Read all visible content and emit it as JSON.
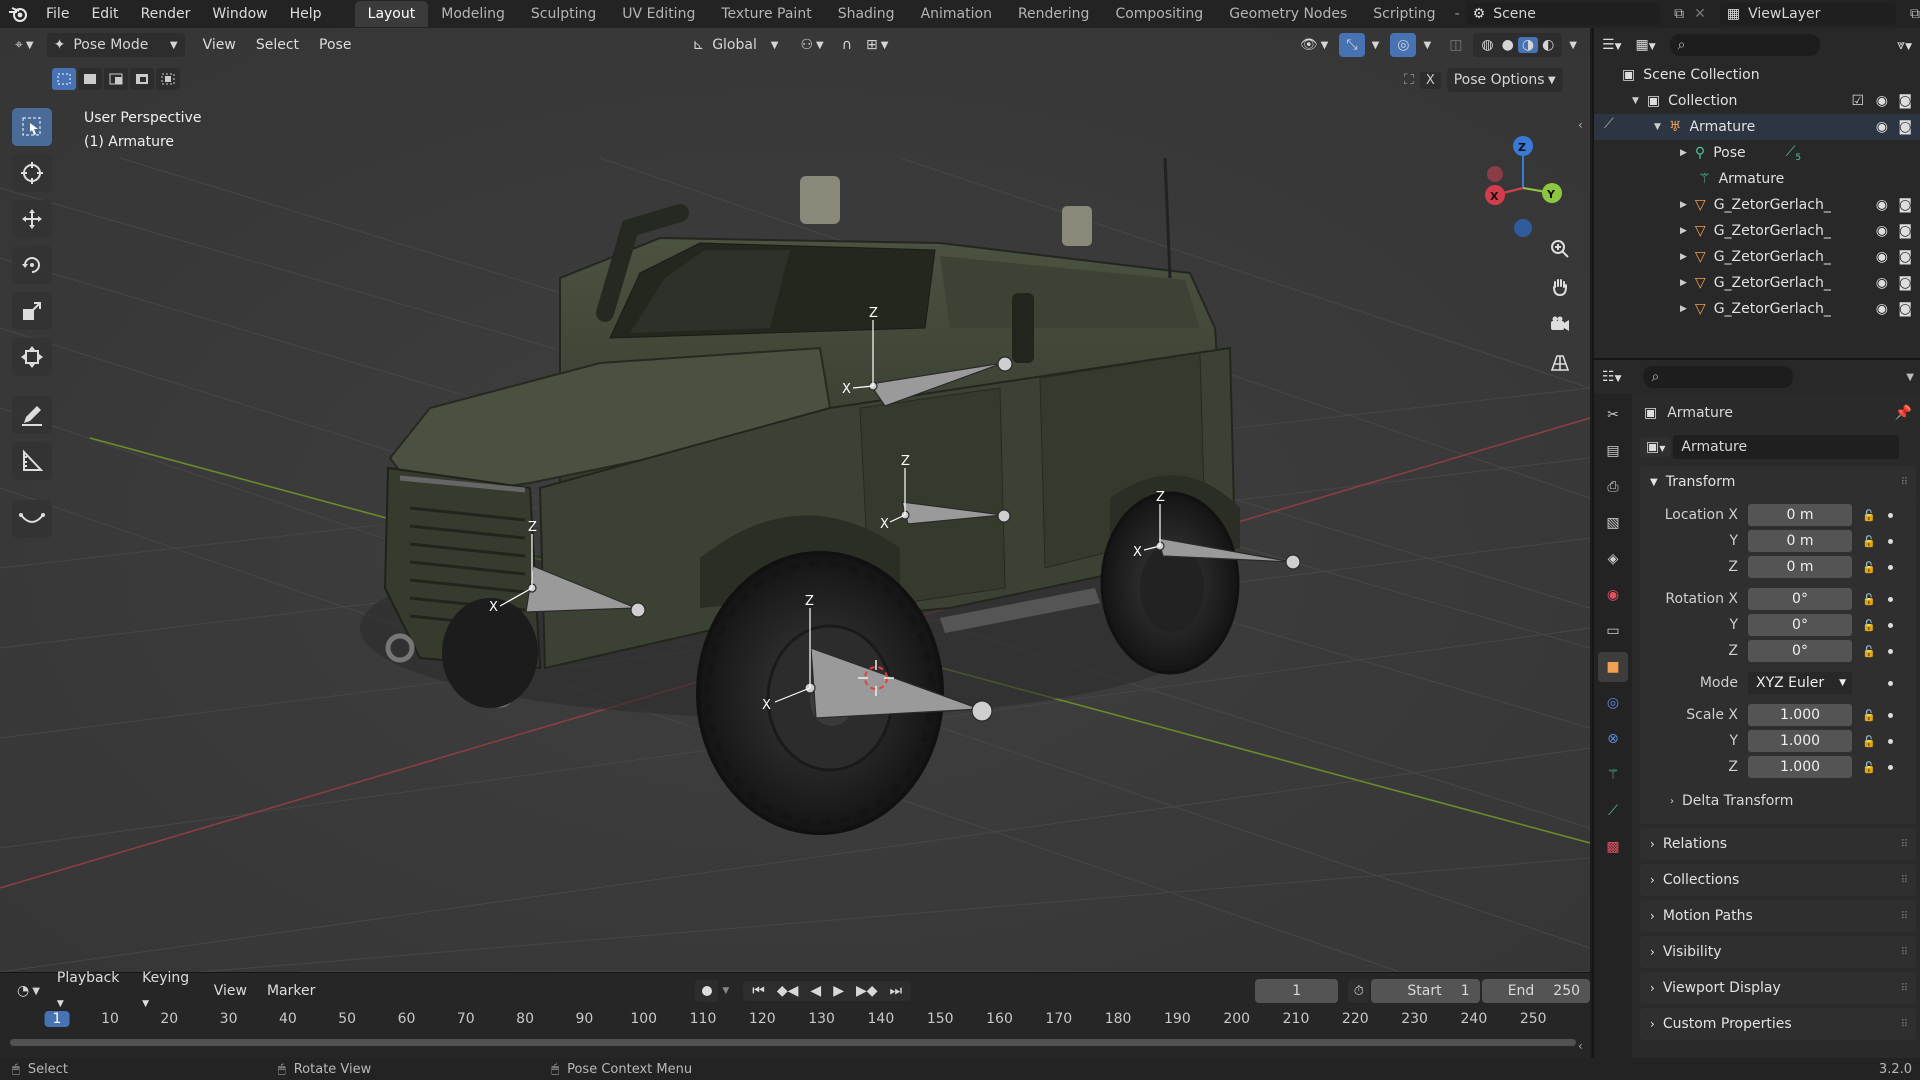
{
  "topbar": {
    "menus": [
      "File",
      "Edit",
      "Render",
      "Window",
      "Help"
    ],
    "workspaces": [
      "Layout",
      "Modeling",
      "Sculpting",
      "UV Editing",
      "Texture Paint",
      "Shading",
      "Animation",
      "Rendering",
      "Compositing",
      "Geometry Nodes",
      "Scripting"
    ],
    "active_workspace": "Layout",
    "scene_name": "Scene",
    "view_layer": "ViewLayer"
  },
  "viewport": {
    "mode_label": "Pose Mode",
    "menus": [
      "View",
      "Select",
      "Pose"
    ],
    "orientation": "Global",
    "pose_options": "Pose Options",
    "overlay_text_line1": "User Perspective",
    "overlay_text_line2": "(1) Armature",
    "gizmo_axes": {
      "x": "X",
      "y": "Y",
      "z": "Z"
    },
    "bone_axis_labels": {
      "x": "X",
      "z": "Z"
    },
    "icons": [
      "select-box-icon",
      "cursor-icon",
      "move-icon",
      "rotate-icon",
      "scale-icon",
      "transform-icon",
      "annotate-icon",
      "measure-icon",
      "relax-icon"
    ]
  },
  "timeline": {
    "menus": [
      "Playback",
      "Keying",
      "View",
      "Marker"
    ],
    "current_frame": "1",
    "start_label": "Start",
    "start_value": "1",
    "end_label": "End",
    "end_value": "250",
    "ruler": [
      "1",
      "10",
      "20",
      "30",
      "40",
      "50",
      "60",
      "70",
      "80",
      "90",
      "100",
      "110",
      "120",
      "130",
      "140",
      "150",
      "160",
      "170",
      "180",
      "190",
      "200",
      "210",
      "220",
      "230",
      "240",
      "250"
    ]
  },
  "statusbar": {
    "items": [
      "Select",
      "Rotate View",
      "Pose Context Menu"
    ],
    "version": "3.2.0"
  },
  "outliner": {
    "root": "Scene Collection",
    "collection": "Collection",
    "armature": "Armature",
    "pose": "Pose",
    "pose_count": "5",
    "armature_data": "Armature",
    "meshes": [
      "G_ZetorGerlach_",
      "G_ZetorGerlach_",
      "G_ZetorGerlach_",
      "G_ZetorGerlach_",
      "G_ZetorGerlach_"
    ]
  },
  "properties": {
    "object_name": "Armature",
    "datablock": "Armature",
    "transform_label": "Transform",
    "location": {
      "label_x": "Location X",
      "label_y": "Y",
      "label_z": "Z",
      "x": "0 m",
      "y": "0 m",
      "z": "0 m"
    },
    "rotation": {
      "label_x": "Rotation X",
      "label_y": "Y",
      "label_z": "Z",
      "x": "0°",
      "y": "0°",
      "z": "0°"
    },
    "mode_label": "Mode",
    "mode_value": "XYZ Euler",
    "scale": {
      "label_x": "Scale X",
      "label_y": "Y",
      "label_z": "Z",
      "x": "1.000",
      "y": "1.000",
      "z": "1.000"
    },
    "subpanels": [
      "Delta Transform",
      "Relations",
      "Collections",
      "Motion Paths",
      "Visibility",
      "Viewport Display",
      "Custom Properties"
    ]
  },
  "colors": {
    "accent": "#4772b3",
    "x_axis": "#d43c4c",
    "y_axis": "#8dc63f",
    "z_axis": "#3a79d6"
  }
}
